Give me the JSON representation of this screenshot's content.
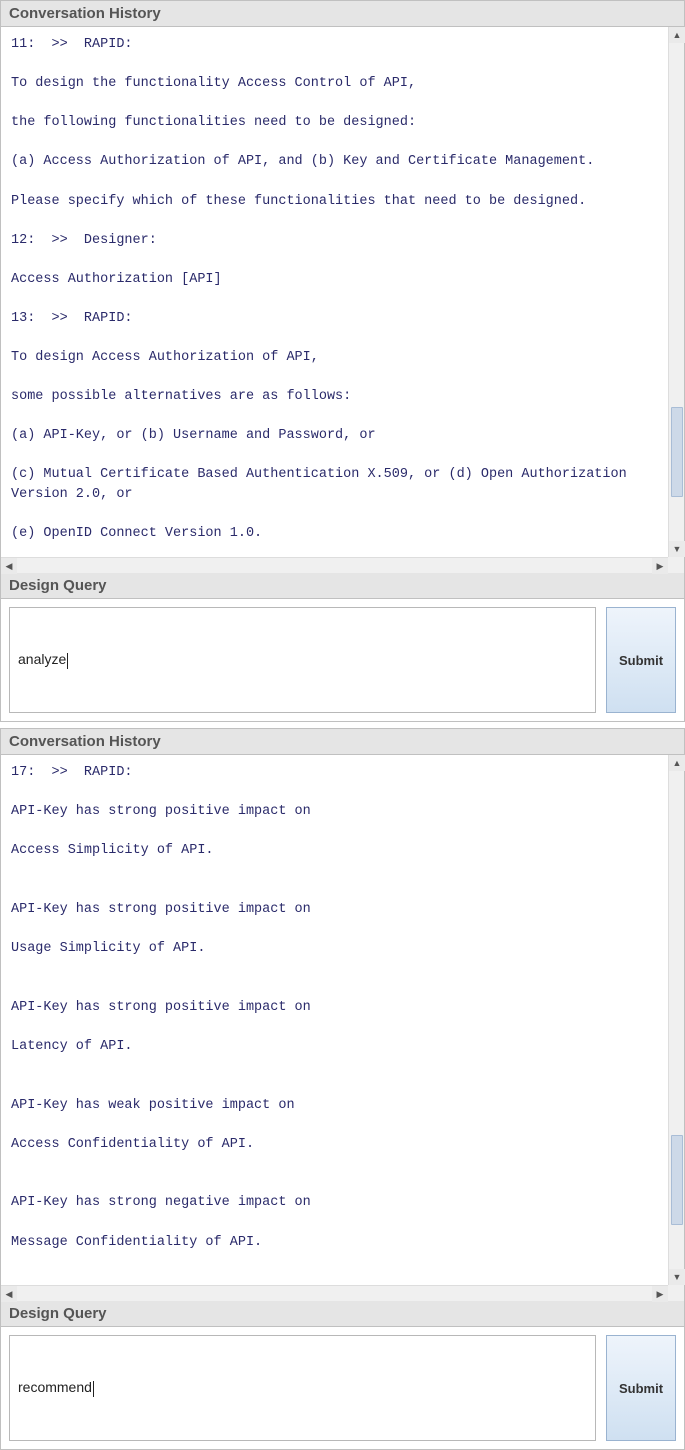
{
  "panel1": {
    "history_label": "Conversation History",
    "history_text": "11:  >>  RAPID:\n\nTo design the functionality Access Control of API,\n\nthe following functionalities need to be designed:\n\n(a) Access Authorization of API, and (b) Key and Certificate Management.\n\nPlease specify which of these functionalities that need to be designed.\n\n12:  >>  Designer:\n\nAccess Authorization [API]\n\n13:  >>  RAPID:\n\nTo design Access Authorization of API,\n\nsome possible alternatives are as follows:\n\n(a) API-Key, or (b) Username and Password, or\n\n(c) Mutual Certificate Based Authentication X.509, or (d) Open Authorization Version 2.0, or\n\n(e) OpenID Connect Version 1.0.\n\n\nI cannot futher refine the above design alterantives.For the next step,\n\nI can analyze the above design alternatives or I can recommend a design solution.",
    "query_label": "Design Query",
    "query_value": "analyze",
    "submit_label": "Submit"
  },
  "panel2": {
    "history_label": "Conversation History",
    "history_text": "17:  >>  RAPID:\n\nAPI-Key has strong positive impact on\n\nAccess Simplicity of API.\n\n\nAPI-Key has strong positive impact on\n\nUsage Simplicity of API.\n\n\nAPI-Key has strong positive impact on\n\nLatency of API.\n\n\nAPI-Key has weak positive impact on\n\nAccess Confidentiality of API.\n\n\nAPI-Key has strong negative impact on\n\nMessage Confidentiality of API.\n\n\nAPI-Key has strong negative impact on\n\nPrivacy of API.",
    "query_label": "Design Query",
    "query_value": "recommend",
    "submit_label": "Submit"
  }
}
